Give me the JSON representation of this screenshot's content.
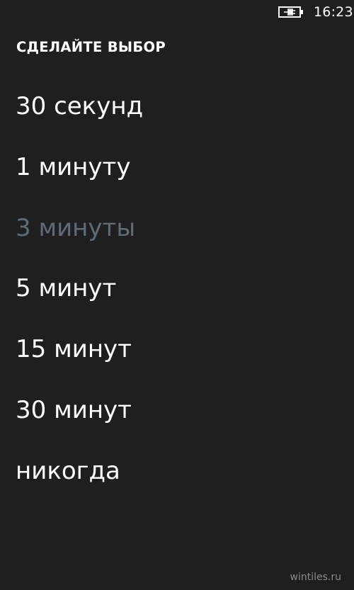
{
  "status_bar": {
    "battery_icon": "battery-charging-icon",
    "time": "16:23"
  },
  "picker": {
    "header": "СДЕЛАЙТЕ ВЫБОР",
    "options": [
      {
        "label": "30 секунд",
        "selected": false
      },
      {
        "label": "1 минуту",
        "selected": false
      },
      {
        "label": "3 минуты",
        "selected": true
      },
      {
        "label": "5 минут",
        "selected": false
      },
      {
        "label": "15 минут",
        "selected": false
      },
      {
        "label": "30 минут",
        "selected": false
      },
      {
        "label": "никогда",
        "selected": false
      }
    ],
    "selected_color": "#5f6b78",
    "text_color": "#ffffff",
    "background_color": "#1f1f1f"
  },
  "watermark": "wintiles.ru"
}
